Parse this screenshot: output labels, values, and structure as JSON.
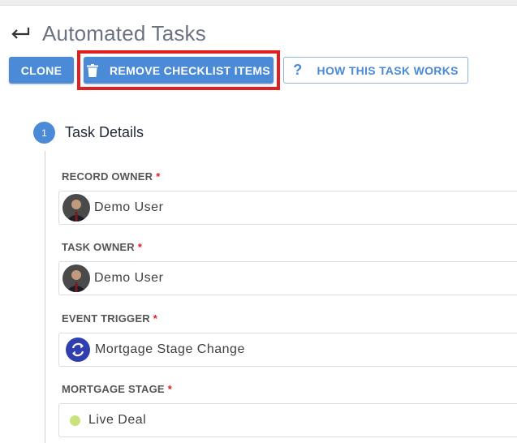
{
  "page": {
    "title": "Automated Tasks"
  },
  "toolbar": {
    "clone_label": "CLONE",
    "remove_label": "REMOVE CHECKLIST ITEMS",
    "how_label": "HOW THIS TASK WORKS",
    "how_glyph": "?"
  },
  "step": {
    "number": "1",
    "title": "Task Details"
  },
  "fields": {
    "record_owner": {
      "label": "RECORD OWNER",
      "required": "*",
      "value": "Demo User"
    },
    "task_owner": {
      "label": "TASK OWNER",
      "required": "*",
      "value": "Demo User"
    },
    "event_trigger": {
      "label": "EVENT TRIGGER",
      "required": "*",
      "value": "Mortgage Stage Change"
    },
    "mortgage_stage": {
      "label": "MORTGAGE STAGE",
      "required": "*",
      "value": "Live Deal"
    }
  },
  "icons": {
    "back": "return-arrow-icon",
    "trash": "trash-icon",
    "help": "question-icon",
    "trigger": "sync-icon"
  },
  "colors": {
    "primary": "#4a8ad6",
    "highlight": "#e02020",
    "required": "#e02020",
    "trigger_bg": "#2f3fb0",
    "stage_dot": "#c9e27a"
  }
}
